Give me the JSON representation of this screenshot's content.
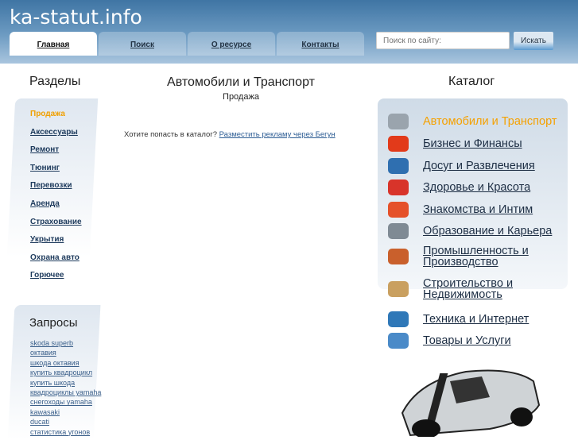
{
  "header": {
    "logo": "ka-statut.info",
    "tabs": [
      "Главная",
      "Поиск",
      "О ресурсе",
      "Контакты"
    ],
    "search_placeholder": "Поиск по сайту:",
    "search_button": "Искать"
  },
  "sections": {
    "title": "Разделы",
    "items": [
      "Продажа",
      "Аксессуары",
      "Ремонт",
      "Тюнинг",
      "Перевозки",
      "Аренда",
      "Страхование",
      "Укрытия",
      "Охрана авто",
      "Горючее"
    ]
  },
  "queries": {
    "title": "Запросы",
    "items": [
      "skoda superb",
      "октавия",
      "шкода октавия",
      "купить квадроцикл",
      "купить шкода",
      "квадроциклы yamaha",
      "снегоходы yamaha",
      "kawasaki",
      "ducati",
      "статистика угонов"
    ]
  },
  "main": {
    "title": "Автомобили и Транспорт",
    "subtitle": "Продажа",
    "ad_text": "Хотите попасть в каталог?",
    "ad_link": "Разместить рекламу через Бегун"
  },
  "catalog": {
    "title": "Каталог",
    "items": [
      {
        "label": "Автомобили и Транспорт",
        "icon": "car-icon",
        "color": "#9aa4ad"
      },
      {
        "label": "Бизнес и Финансы",
        "icon": "pie-chart-icon",
        "color": "#e23a1a"
      },
      {
        "label": "Досуг и Развлечения",
        "icon": "bowling-icon",
        "color": "#2f6fb0"
      },
      {
        "label": "Здоровье и Красота",
        "icon": "cosmetics-icon",
        "color": "#d8342a"
      },
      {
        "label": "Знакомства и Интим",
        "icon": "heart-icon",
        "color": "#e5512a"
      },
      {
        "label": "Образование и Карьера",
        "icon": "briefcase-icon",
        "color": "#7f8a94"
      },
      {
        "label": "Промышленность и Производство",
        "icon": "factory-icon",
        "color": "#c9602c"
      },
      {
        "label": "Строительство и Недвижимость",
        "icon": "construction-icon",
        "color": "#c9a060"
      },
      {
        "label": "Техника и Интернет",
        "icon": "computer-icon",
        "color": "#2f78b8"
      },
      {
        "label": "Товары и Услуги",
        "icon": "shopping-bag-icon",
        "color": "#4a8ac8"
      }
    ]
  }
}
